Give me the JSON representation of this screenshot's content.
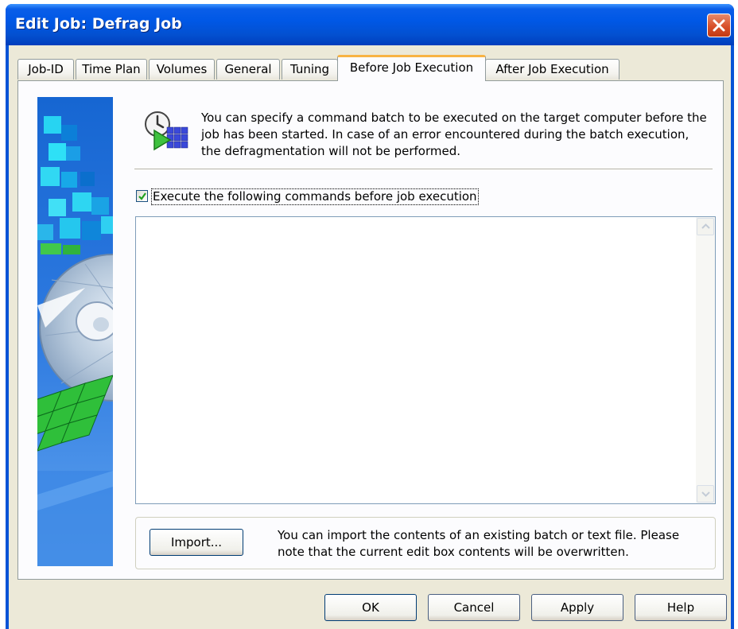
{
  "window": {
    "title": "Edit Job: Defrag Job"
  },
  "tabs": [
    {
      "label": "Job-ID",
      "active": false
    },
    {
      "label": "Time Plan",
      "active": false
    },
    {
      "label": "Volumes",
      "active": false
    },
    {
      "label": "General",
      "active": false
    },
    {
      "label": "Tuning",
      "active": false
    },
    {
      "label": "Before Job Execution",
      "active": true
    },
    {
      "label": "After Job Execution",
      "active": false
    }
  ],
  "panel": {
    "description": "You can specify a command batch to be executed on the target computer before the job has been started. In case of an error encountered during the batch execution, the defragmentation will not be performed.",
    "checkbox": {
      "label": "Execute the following commands before job execution",
      "checked": true
    },
    "commands": {
      "value": ""
    },
    "import": {
      "button_label": "Import...",
      "description": "You can import the contents of an existing batch or text file. Please note that the current edit box contents will be overwritten."
    }
  },
  "buttons": {
    "ok": "OK",
    "cancel": "Cancel",
    "apply": "Apply",
    "help": "Help"
  },
  "colors": {
    "title_bar": "#0058e6",
    "dialog_bg": "#ece9d8",
    "active_tab_accent": "#f8b343",
    "close_button": "#d8502a"
  }
}
